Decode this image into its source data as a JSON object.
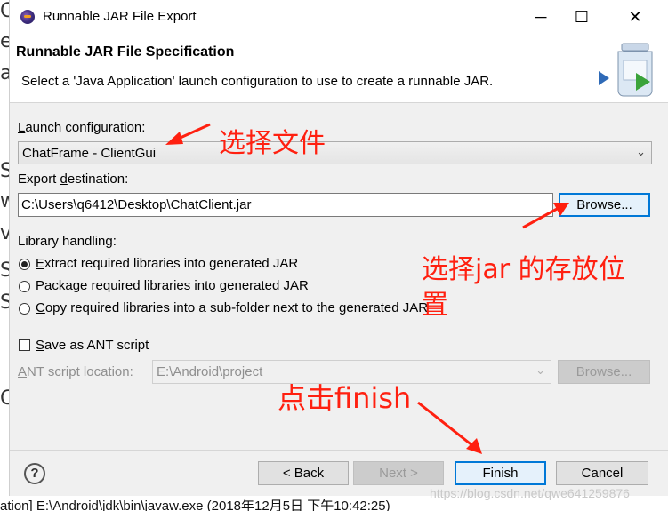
{
  "window": {
    "title": "Runnable JAR File Export",
    "minimize_glyph": "─",
    "maximize_glyph": "☐",
    "close_glyph": "✕"
  },
  "banner": {
    "title": "Runnable JAR File Specification",
    "description": "Select a 'Java Application' launch configuration to use to create a runnable JAR."
  },
  "launch": {
    "label_mnemonic": "L",
    "label_rest": "aunch configuration:",
    "value": "ChatFrame - ClientGui"
  },
  "export": {
    "label_before": "Export ",
    "label_mnemonic": "d",
    "label_after": "estination:",
    "value": "C:\\Users\\q6412\\Desktop\\ChatClient.jar",
    "browse_label": "Browse..."
  },
  "library": {
    "label": "Library handling:",
    "options": [
      {
        "mnemonic": "E",
        "rest": "xtract required libraries into generated JAR",
        "checked": true
      },
      {
        "mnemonic": "P",
        "rest": "ackage required libraries into generated JAR",
        "checked": false
      },
      {
        "mnemonic": "C",
        "rest": "opy required libraries into a sub-folder next to the generated JAR",
        "checked": false
      }
    ]
  },
  "ant": {
    "checkbox_mnemonic": "S",
    "checkbox_rest": "ave as ANT script",
    "location_label_mnemonic": "A",
    "location_label_rest": "NT script location:",
    "location_value": "E:\\Android\\project",
    "browse_label": "Browse..."
  },
  "footer": {
    "help_glyph": "?",
    "back_label": "< Back",
    "next_label": "Next >",
    "finish_label": "Finish",
    "cancel_label": "Cancel"
  },
  "annotations": {
    "select_file": "选择文件",
    "select_jar_line1": "选择jar 的存放位",
    "select_jar_line2": "置",
    "click_finish": "点击finish"
  },
  "background": {
    "left_letters": [
      "C",
      "e",
      "a",
      "S",
      "w",
      "v",
      "S",
      "S",
      "C"
    ],
    "console_line": "ation] E:\\Android\\jdk\\bin\\javaw.exe (2018年12月5日 下午10:42:25)",
    "watermark": "https://blog.csdn.net/qwe641259876"
  },
  "colors": {
    "annotation_red": "#ff2010",
    "focus_blue": "#0078d7"
  }
}
